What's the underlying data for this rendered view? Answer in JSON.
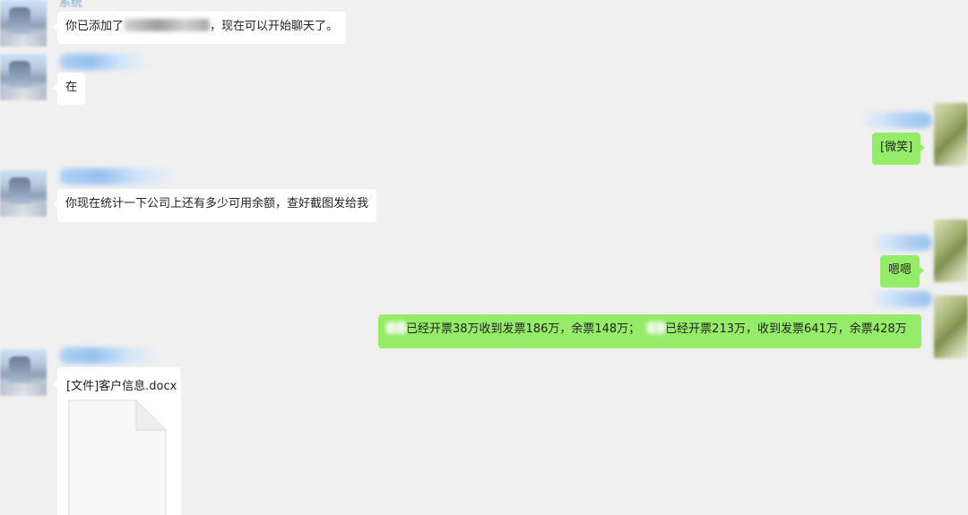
{
  "messages": [
    {
      "side": "left",
      "sender": "系统",
      "parts": [
        "你已添加了",
        "，现在可以开始聊天了。"
      ]
    },
    {
      "side": "left",
      "text": "在"
    },
    {
      "side": "right",
      "text": "[微笑]"
    },
    {
      "side": "left",
      "text": "你现在统计一下公司上还有多少可用余额，查好截图发给我"
    },
    {
      "side": "right",
      "text": "嗯嗯"
    },
    {
      "side": "right",
      "parts": [
        "已经开票38万收到发票186万，余票148万；",
        "已经开票213万，收到发票641万，余票428万"
      ]
    },
    {
      "side": "left",
      "file_title": "[文件]客户信息.docx",
      "icon": "document-icon"
    }
  ]
}
